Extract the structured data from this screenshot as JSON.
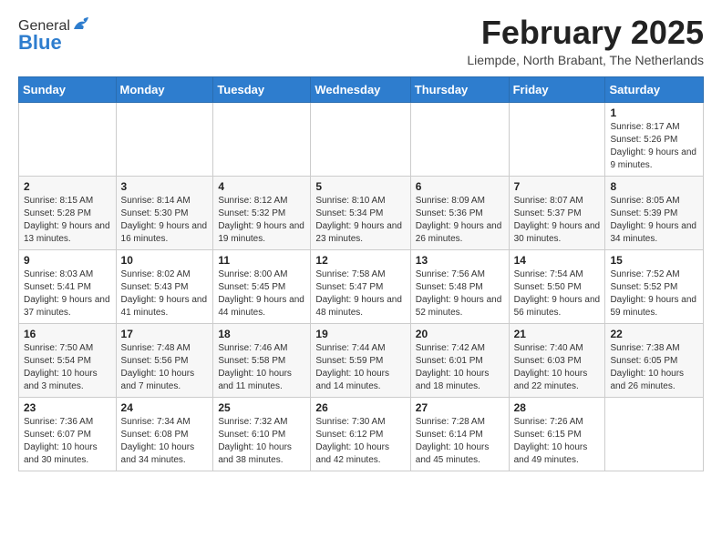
{
  "header": {
    "logo": {
      "general": "General",
      "blue": "Blue"
    },
    "title": "February 2025",
    "location": "Liempde, North Brabant, The Netherlands"
  },
  "days_of_week": [
    "Sunday",
    "Monday",
    "Tuesday",
    "Wednesday",
    "Thursday",
    "Friday",
    "Saturday"
  ],
  "weeks": [
    [
      {
        "day": "",
        "info": ""
      },
      {
        "day": "",
        "info": ""
      },
      {
        "day": "",
        "info": ""
      },
      {
        "day": "",
        "info": ""
      },
      {
        "day": "",
        "info": ""
      },
      {
        "day": "",
        "info": ""
      },
      {
        "day": "1",
        "info": "Sunrise: 8:17 AM\nSunset: 5:26 PM\nDaylight: 9 hours and 9 minutes."
      }
    ],
    [
      {
        "day": "2",
        "info": "Sunrise: 8:15 AM\nSunset: 5:28 PM\nDaylight: 9 hours and 13 minutes."
      },
      {
        "day": "3",
        "info": "Sunrise: 8:14 AM\nSunset: 5:30 PM\nDaylight: 9 hours and 16 minutes."
      },
      {
        "day": "4",
        "info": "Sunrise: 8:12 AM\nSunset: 5:32 PM\nDaylight: 9 hours and 19 minutes."
      },
      {
        "day": "5",
        "info": "Sunrise: 8:10 AM\nSunset: 5:34 PM\nDaylight: 9 hours and 23 minutes."
      },
      {
        "day": "6",
        "info": "Sunrise: 8:09 AM\nSunset: 5:36 PM\nDaylight: 9 hours and 26 minutes."
      },
      {
        "day": "7",
        "info": "Sunrise: 8:07 AM\nSunset: 5:37 PM\nDaylight: 9 hours and 30 minutes."
      },
      {
        "day": "8",
        "info": "Sunrise: 8:05 AM\nSunset: 5:39 PM\nDaylight: 9 hours and 34 minutes."
      }
    ],
    [
      {
        "day": "9",
        "info": "Sunrise: 8:03 AM\nSunset: 5:41 PM\nDaylight: 9 hours and 37 minutes."
      },
      {
        "day": "10",
        "info": "Sunrise: 8:02 AM\nSunset: 5:43 PM\nDaylight: 9 hours and 41 minutes."
      },
      {
        "day": "11",
        "info": "Sunrise: 8:00 AM\nSunset: 5:45 PM\nDaylight: 9 hours and 44 minutes."
      },
      {
        "day": "12",
        "info": "Sunrise: 7:58 AM\nSunset: 5:47 PM\nDaylight: 9 hours and 48 minutes."
      },
      {
        "day": "13",
        "info": "Sunrise: 7:56 AM\nSunset: 5:48 PM\nDaylight: 9 hours and 52 minutes."
      },
      {
        "day": "14",
        "info": "Sunrise: 7:54 AM\nSunset: 5:50 PM\nDaylight: 9 hours and 56 minutes."
      },
      {
        "day": "15",
        "info": "Sunrise: 7:52 AM\nSunset: 5:52 PM\nDaylight: 9 hours and 59 minutes."
      }
    ],
    [
      {
        "day": "16",
        "info": "Sunrise: 7:50 AM\nSunset: 5:54 PM\nDaylight: 10 hours and 3 minutes."
      },
      {
        "day": "17",
        "info": "Sunrise: 7:48 AM\nSunset: 5:56 PM\nDaylight: 10 hours and 7 minutes."
      },
      {
        "day": "18",
        "info": "Sunrise: 7:46 AM\nSunset: 5:58 PM\nDaylight: 10 hours and 11 minutes."
      },
      {
        "day": "19",
        "info": "Sunrise: 7:44 AM\nSunset: 5:59 PM\nDaylight: 10 hours and 14 minutes."
      },
      {
        "day": "20",
        "info": "Sunrise: 7:42 AM\nSunset: 6:01 PM\nDaylight: 10 hours and 18 minutes."
      },
      {
        "day": "21",
        "info": "Sunrise: 7:40 AM\nSunset: 6:03 PM\nDaylight: 10 hours and 22 minutes."
      },
      {
        "day": "22",
        "info": "Sunrise: 7:38 AM\nSunset: 6:05 PM\nDaylight: 10 hours and 26 minutes."
      }
    ],
    [
      {
        "day": "23",
        "info": "Sunrise: 7:36 AM\nSunset: 6:07 PM\nDaylight: 10 hours and 30 minutes."
      },
      {
        "day": "24",
        "info": "Sunrise: 7:34 AM\nSunset: 6:08 PM\nDaylight: 10 hours and 34 minutes."
      },
      {
        "day": "25",
        "info": "Sunrise: 7:32 AM\nSunset: 6:10 PM\nDaylight: 10 hours and 38 minutes."
      },
      {
        "day": "26",
        "info": "Sunrise: 7:30 AM\nSunset: 6:12 PM\nDaylight: 10 hours and 42 minutes."
      },
      {
        "day": "27",
        "info": "Sunrise: 7:28 AM\nSunset: 6:14 PM\nDaylight: 10 hours and 45 minutes."
      },
      {
        "day": "28",
        "info": "Sunrise: 7:26 AM\nSunset: 6:15 PM\nDaylight: 10 hours and 49 minutes."
      },
      {
        "day": "",
        "info": ""
      }
    ]
  ]
}
